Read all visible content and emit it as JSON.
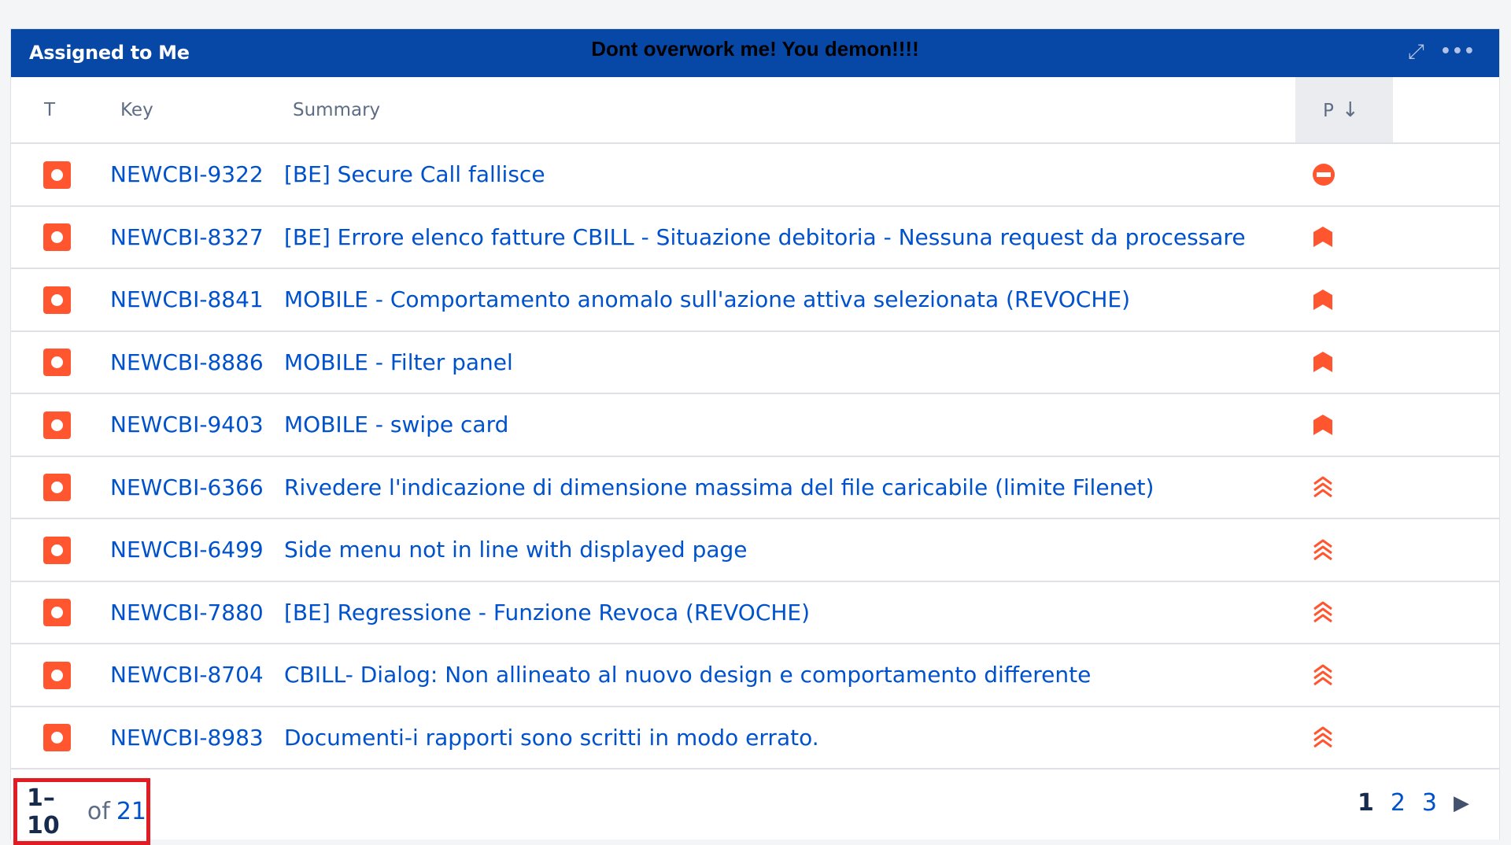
{
  "gadget": {
    "title": "Assigned to Me",
    "banner": "Dont overwork me! You demon!!!!"
  },
  "columns": {
    "type": "T",
    "key": "Key",
    "summary": "Summary",
    "priority": "P"
  },
  "issues": [
    {
      "key": "NEWCBI-9322",
      "summary": "[BE] Secure Call fallisce",
      "priority": "blocker"
    },
    {
      "key": "NEWCBI-8327",
      "summary": "[BE] Errore elenco fatture CBILL - Situazione debitoria - Nessuna request da processare",
      "priority": "critical"
    },
    {
      "key": "NEWCBI-8841",
      "summary": "MOBILE - Comportamento anomalo sull'azione attiva selezionata (REVOCHE)",
      "priority": "critical"
    },
    {
      "key": "NEWCBI-8886",
      "summary": "MOBILE - Filter panel",
      "priority": "critical"
    },
    {
      "key": "NEWCBI-9403",
      "summary": "MOBILE - swipe card",
      "priority": "critical"
    },
    {
      "key": "NEWCBI-6366",
      "summary": "Rivedere l'indicazione di dimensione massima del file caricabile (limite Filenet)",
      "priority": "highest"
    },
    {
      "key": "NEWCBI-6499",
      "summary": "Side menu not in line with displayed page",
      "priority": "highest"
    },
    {
      "key": "NEWCBI-7880",
      "summary": "[BE] Regressione - Funzione Revoca (REVOCHE)",
      "priority": "highest"
    },
    {
      "key": "NEWCBI-8704",
      "summary": "CBILL- Dialog: Non allineato al nuovo design e comportamento differente",
      "priority": "highest"
    },
    {
      "key": "NEWCBI-8983",
      "summary": "Documenti-i rapporti sono scritti in modo errato.",
      "priority": "highest"
    }
  ],
  "footer": {
    "range": "1–10",
    "of": "of",
    "total": "21",
    "pages": [
      "1",
      "2",
      "3"
    ],
    "current_page": "1"
  },
  "colors": {
    "header_bg": "#0747a6",
    "link": "#0052cc",
    "bug": "#ff5630",
    "priority": "#ff5630",
    "highlight_box": "#e31b23"
  }
}
